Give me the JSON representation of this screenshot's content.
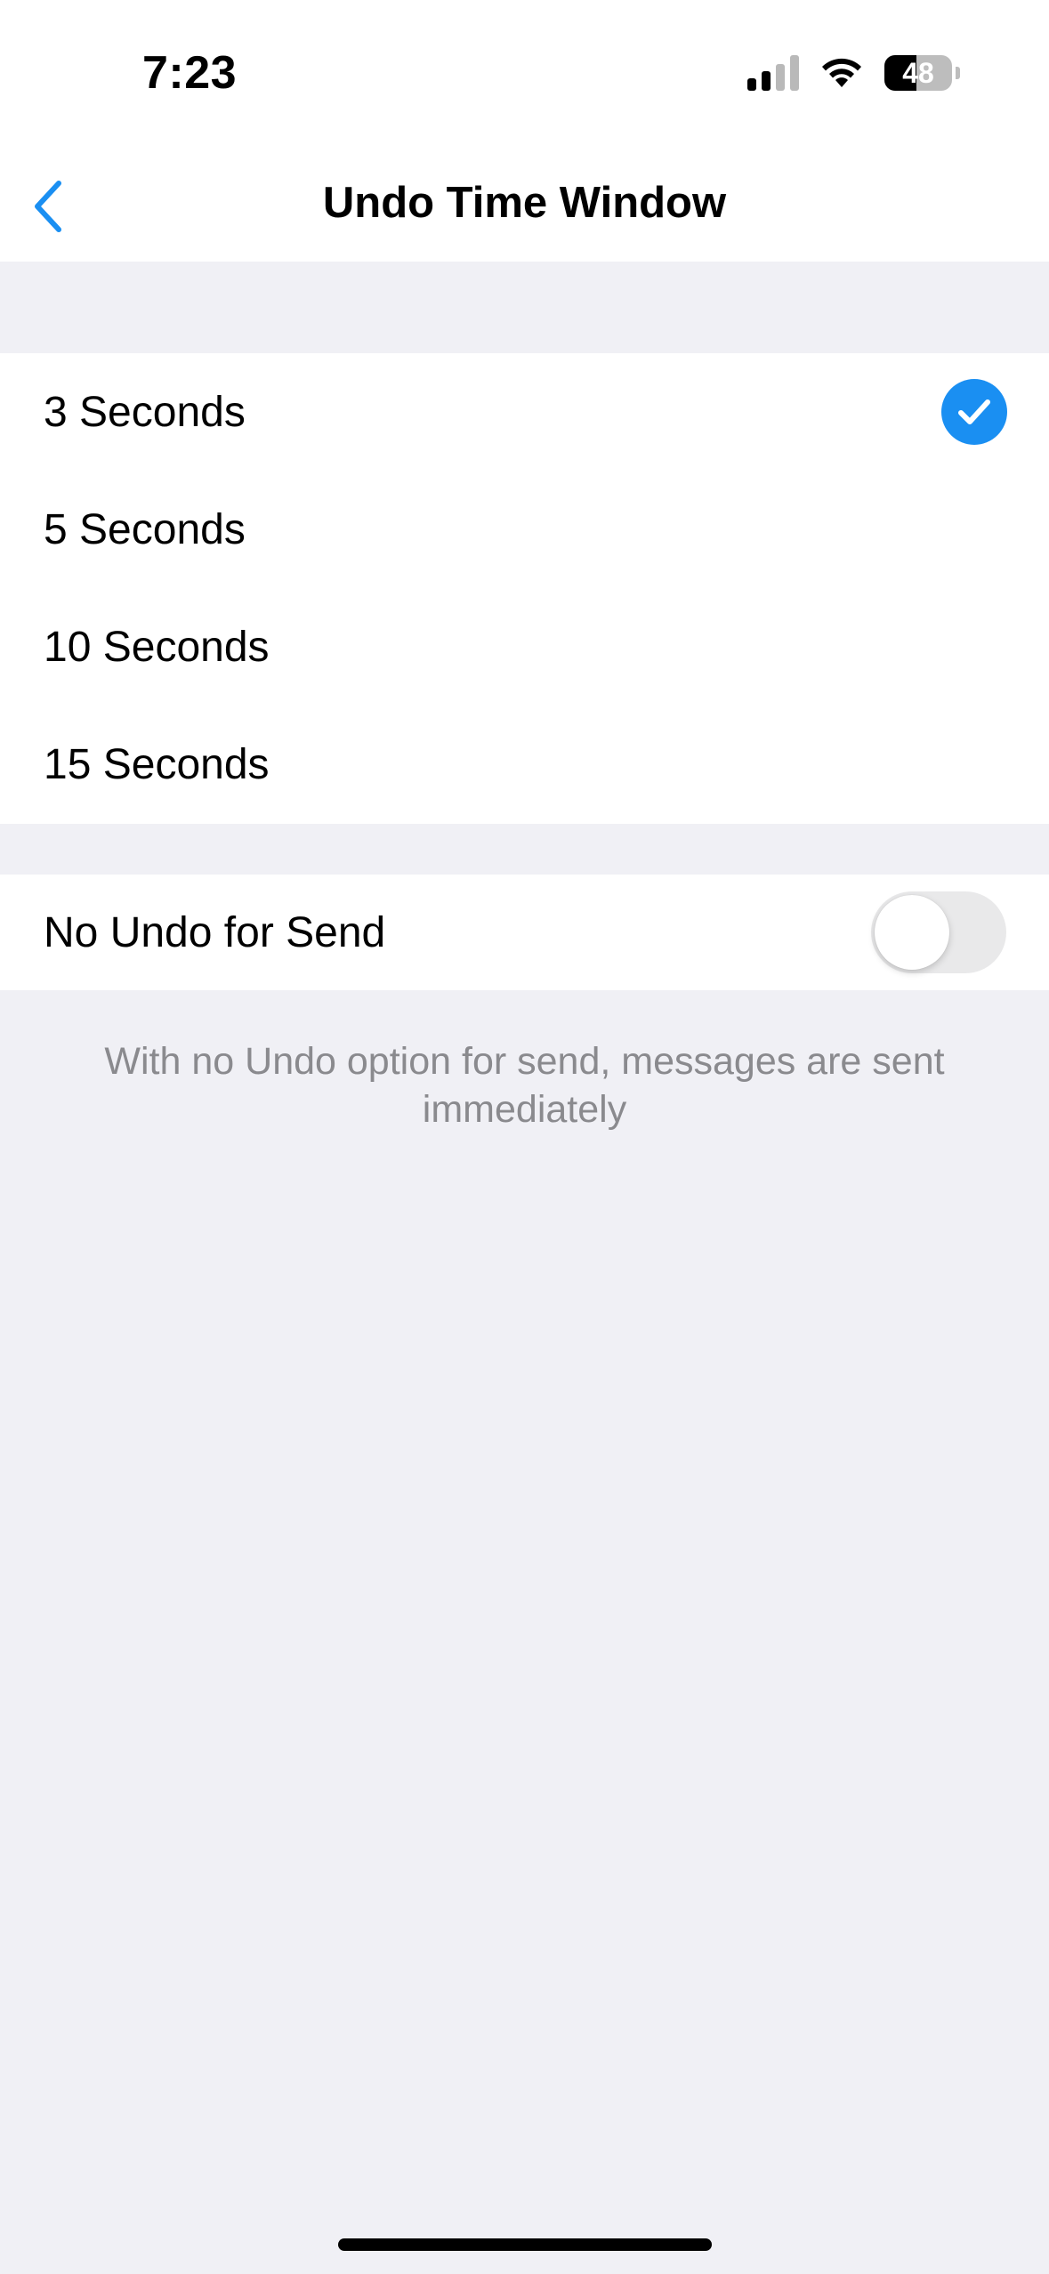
{
  "status_bar": {
    "time": "7:23",
    "battery_level": "48",
    "battery_fraction": 0.48,
    "signal_bars_active": 2,
    "signal_bars_total": 4
  },
  "nav": {
    "back_icon": "chevron-left-icon",
    "title": "Undo Time Window",
    "accent_color": "#1a8ff2"
  },
  "options": [
    {
      "label": "3 Seconds",
      "selected": true
    },
    {
      "label": "5 Seconds",
      "selected": false
    },
    {
      "label": "10 Seconds",
      "selected": false
    },
    {
      "label": "15 Seconds",
      "selected": false
    }
  ],
  "no_undo": {
    "label": "No Undo for Send",
    "enabled": false,
    "note": "With no Undo option for send, messages are sent immediately"
  },
  "colors": {
    "background": "#f0f0f5",
    "checkmark": "#1a8ff2",
    "toggle_off": "#e9e9ea",
    "secondary_text": "#8a8a8e"
  }
}
